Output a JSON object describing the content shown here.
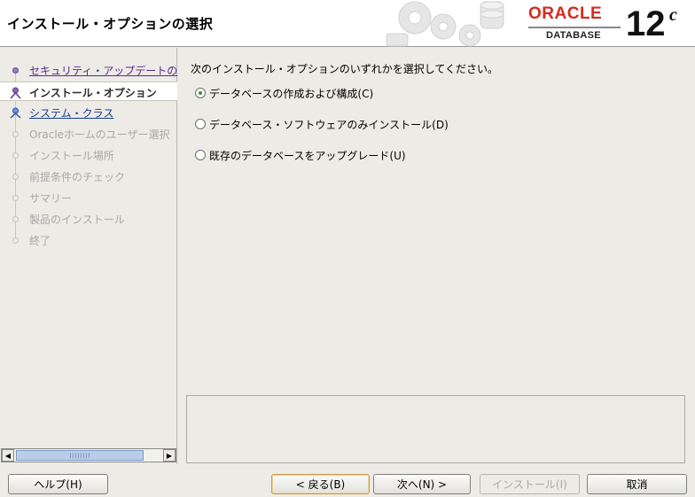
{
  "header": {
    "title": "インストール・オプションの選択",
    "brand": "ORACLE",
    "product": "DATABASE",
    "version_main": "12",
    "version_sup": "c"
  },
  "steps": [
    {
      "label": "セキュリティ・アップデートの",
      "state": "done"
    },
    {
      "label": "インストール・オプション",
      "state": "current"
    },
    {
      "label": "システム・クラス",
      "state": "link"
    },
    {
      "label": "Oracleホームのユーザー選択",
      "state": "disabled"
    },
    {
      "label": "インストール場所",
      "state": "disabled"
    },
    {
      "label": "前提条件のチェック",
      "state": "disabled"
    },
    {
      "label": "サマリー",
      "state": "disabled"
    },
    {
      "label": "製品のインストール",
      "state": "disabled"
    },
    {
      "label": "終了",
      "state": "disabled"
    }
  ],
  "content": {
    "instruction": "次のインストール・オプションのいずれかを選択してください。",
    "options": [
      {
        "label": "データベースの作成および構成(C)",
        "selected": true
      },
      {
        "label": "データベース・ソフトウェアのみインストール(D)",
        "selected": false
      },
      {
        "label": "既存のデータベースをアップグレード(U)",
        "selected": false
      }
    ]
  },
  "buttons": {
    "help": "ヘルプ(H)",
    "back": "< 戻る(B)",
    "next": "次へ(N) >",
    "install": "インストール(I)",
    "cancel": "取消"
  },
  "colors": {
    "brand_red": "#d52b1e",
    "step_done": "#5c2a8c",
    "step_link": "#1a3e8c",
    "step_disabled": "#a8a8a8",
    "background": "#ecebe6"
  }
}
